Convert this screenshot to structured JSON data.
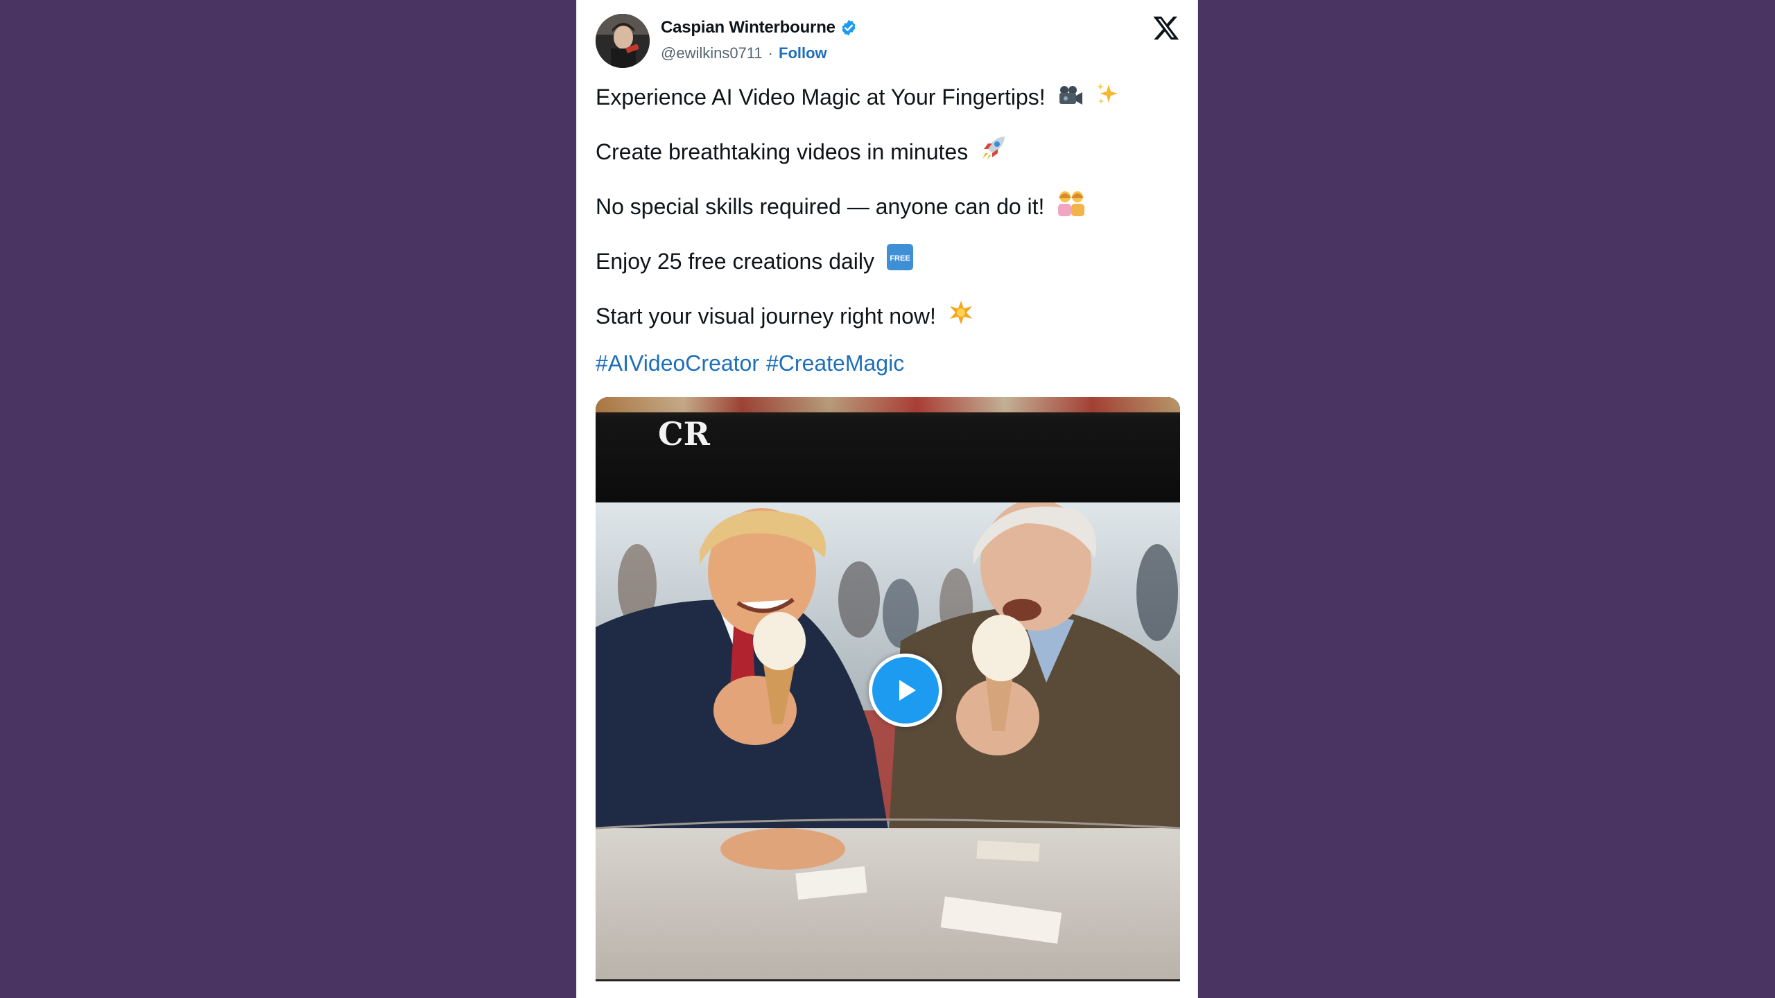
{
  "background_color": "#4a3462",
  "accent_color": "#1d9bf0",
  "link_color": "#1d6fb8",
  "post": {
    "author": {
      "name": "Caspian Winterbourne",
      "handle": "@ewilkins0711",
      "separator": "·",
      "follow_label": "Follow",
      "verified": true,
      "verified_icon": "verified-badge-icon",
      "avatar_icon": "avatar"
    },
    "platform_icon": "x-logo-icon",
    "lines": [
      {
        "text": "Experience AI Video Magic at Your Fingertips!",
        "emoji": [
          "video-camera-icon",
          "sparkles-icon"
        ]
      },
      {
        "text": "Create breathtaking videos in minutes",
        "emoji": [
          "rocket-icon"
        ]
      },
      {
        "text": "No special skills required — anyone can do it!",
        "emoji": [
          "people-icon"
        ]
      },
      {
        "text": "Enjoy 25 free creations daily",
        "emoji": [
          "free-button-icon"
        ]
      },
      {
        "text": "Start your visual journey right now!",
        "emoji": [
          "star-icon"
        ]
      }
    ],
    "free_badge_text": "FREE",
    "hashtags": [
      "#AIVideoCreator",
      "#CreateMagic"
    ],
    "media": {
      "overlay_label": "CR",
      "play_icon": "play-icon"
    }
  }
}
